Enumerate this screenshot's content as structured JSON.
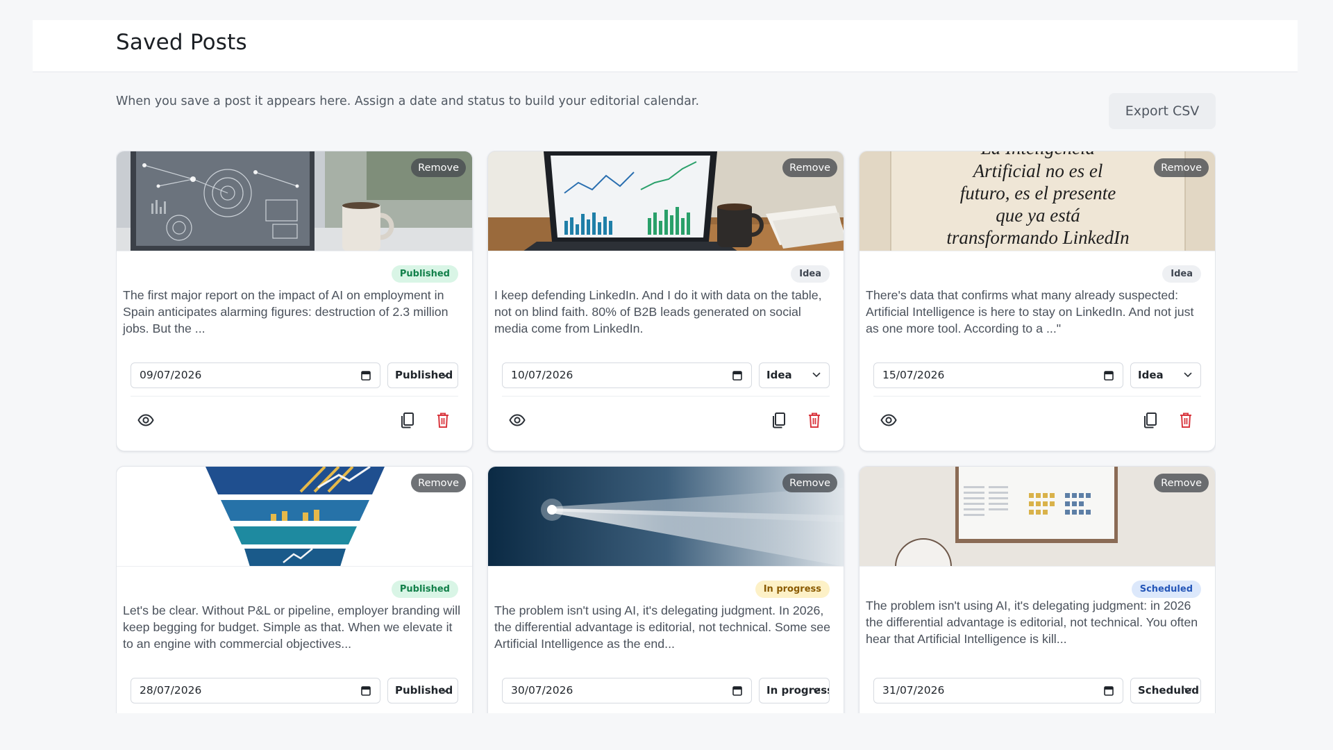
{
  "header": {
    "title": "Saved Posts"
  },
  "intro": {
    "text": "When you save a post it appears here. Assign a date and status to build your editorial calendar."
  },
  "toolbar": {
    "export_label": "Export CSV"
  },
  "cards": [
    {
      "remove_label": "Remove",
      "status_badge": "Published",
      "excerpt": "The first major report on the impact of AI on employment in Spain anticipates alarming figures: destruction of 2.3 million jobs. But the ...",
      "date": "09/07/2026",
      "status_value": "Published",
      "image": "tablet-tech-dashboard"
    },
    {
      "remove_label": "Remove",
      "status_badge": "Idea",
      "excerpt": "I keep defending LinkedIn. And I do it with data on the table, not on blind faith. 80% of B2B leads generated on social media come from LinkedIn.",
      "date": "10/07/2026",
      "status_value": "Idea",
      "image": "laptop-charts-coffee"
    },
    {
      "remove_label": "Remove",
      "status_badge": "Idea",
      "excerpt": "There's data that confirms what many already suspected: Artificial Intelligence is here to stay on LinkedIn. And not just as one more tool. According to a ...\"",
      "date": "15/07/2026",
      "status_value": "Idea",
      "image": "quote-card",
      "image_text": [
        "La Inteligencia",
        "Artificial no es el",
        "futuro, es el presente",
        "que ya está",
        "transformando LinkedIn"
      ]
    },
    {
      "remove_label": "Remove",
      "status_badge": "Published",
      "excerpt": "Let's be clear. Without P&L or pipeline, employer branding will keep begging for budget. Simple as that. When we elevate it to an engine with commercial objectives...",
      "date": "28/07/2026",
      "status_value": "Published",
      "image": "funnel-graphic"
    },
    {
      "remove_label": "Remove",
      "status_badge": "In progress",
      "excerpt": "The problem isn't using AI, it's delegating judgment. In 2026, the differential advantage is editorial, not technical. Some see Artificial Intelligence as the end...",
      "date": "30/07/2026",
      "status_value": "In progress",
      "image": "light-beam"
    },
    {
      "remove_label": "Remove",
      "status_badge": "Scheduled",
      "excerpt": "The problem isn't using AI, it's delegating judgment: in 2026 the differential advantage is editorial, not technical. You often hear that Artificial Intelligence is kill...",
      "date": "31/07/2026",
      "status_value": "Scheduled",
      "image": "calendar-board"
    }
  ],
  "colors": {
    "published_bg": "#d9f5e6",
    "published_text": "#12804a",
    "idea_bg": "#eef0f3",
    "idea_text": "#3f4651",
    "inprogress_bg": "#fdf1c7",
    "inprogress_text": "#8a5a00",
    "scheduled_bg": "#dce8fb",
    "scheduled_text": "#2456b8",
    "delete_red": "#d9363e"
  },
  "icons": {
    "preview": "eye-icon",
    "duplicate": "copy-icon",
    "delete": "trash-icon",
    "date": "calendar-icon",
    "dropdown": "chevron-down-icon"
  }
}
